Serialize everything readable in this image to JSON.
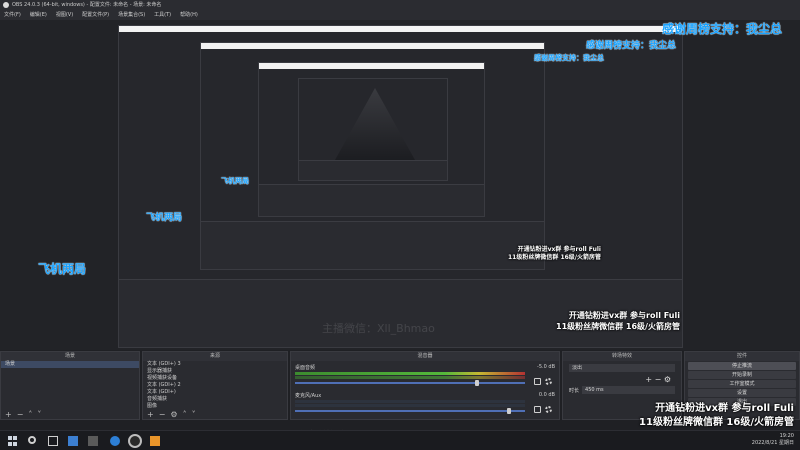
{
  "window": {
    "title": "OBS 24.0.3 (64-bit, windows) - 配置文件: 未命名 - 场景: 未命名"
  },
  "menu": [
    "文件(F)",
    "编辑(E)",
    "视图(V)",
    "配置文件(P)",
    "场景集合(S)",
    "工具(T)",
    "帮助(H)"
  ],
  "overlays": {
    "thanks": "感谢周榜支持：我尘总",
    "airplane": "飞机两局",
    "promo_line1": "开通钻粉进vx群 参与roll  Fuli",
    "promo_line2": "11级粉丝牌微信群 16级/火箭房管",
    "watermark": "主播微信：Xll_Bhmao"
  },
  "docks": {
    "scenes": {
      "title": "场景",
      "items": [
        "场景"
      ]
    },
    "sources": {
      "title": "来源",
      "items": [
        "文本 (GDI+) 3",
        "显示器捕获",
        "视频捕获设备",
        "文本 (GDI+) 2",
        "文本 (GDI+)",
        "音频捕获",
        "图像"
      ]
    },
    "mixer": {
      "title": "混音器",
      "tracks": [
        {
          "name": "桌面音频",
          "db": "-5.0 dB"
        },
        {
          "name": "麦克风/Aux",
          "db": "0.0 dB"
        }
      ]
    },
    "transitions": {
      "title": "转场特效",
      "type": "淡出",
      "duration_label": "时长",
      "duration_value": "450 ms"
    },
    "controls": {
      "title": "控件",
      "buttons": [
        "停止推流",
        "开始录制",
        "工作室模式",
        "设置",
        "退出"
      ]
    }
  },
  "taskbar": {
    "time": "19:20",
    "date": "2022/8/21 星期日"
  },
  "colors": {
    "accent_blue": "#1aa3ff",
    "meter_green": "#54b83b",
    "fader_blue": "#4f6fb5"
  }
}
